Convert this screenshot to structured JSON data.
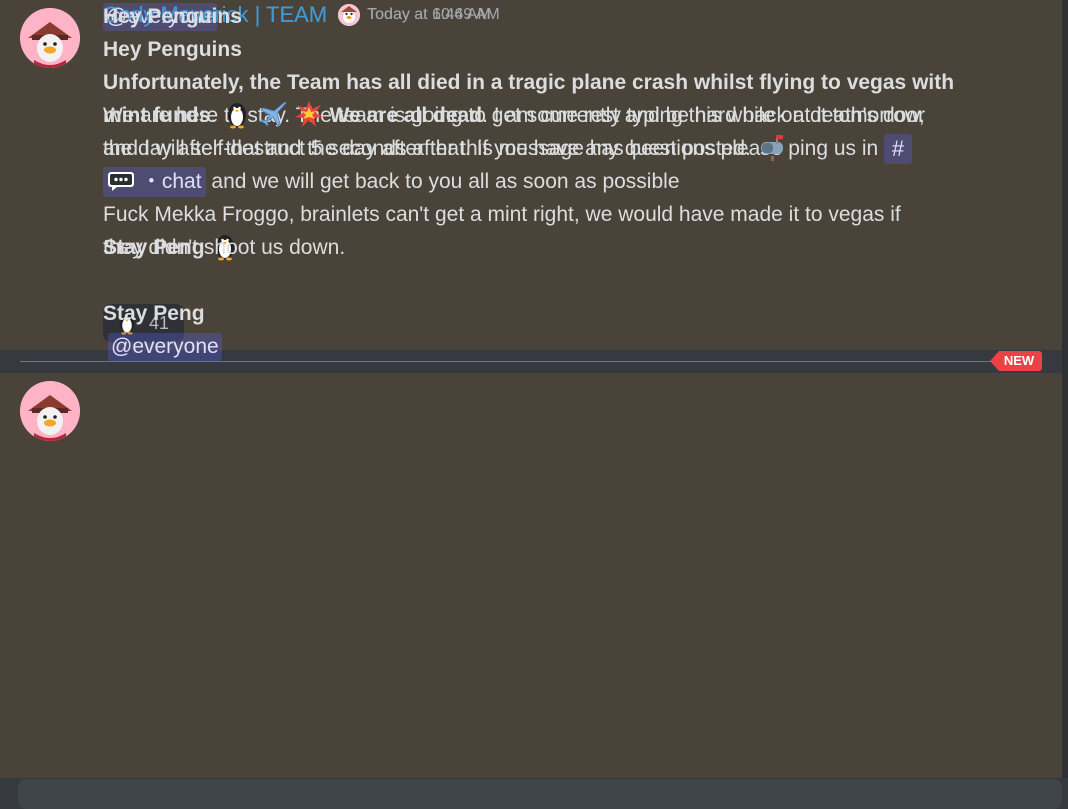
{
  "messages": [
    {
      "username": "Cody Maverick | TEAM",
      "timestamp": "Today at 6:46 AM",
      "mention": "@everyone",
      "greeting": "Hey Penguins",
      "body_line1": "We are here to stay. The team is going to get some rest and be hard back at it tomorrow,",
      "body_line2": "the day after that and the day after that. If you have any questions please ping us in",
      "channel_hash": "#",
      "channel_name": "・chat",
      "body_line3_rest": "and we will get back to you all as soon as possible",
      "signoff": "Stay Peng",
      "reaction": {
        "emoji": "penguin",
        "count": "41"
      }
    },
    {
      "username": "Cody Maverick | TEAM",
      "timestamp": "Today at 10:49 AM",
      "greeting": "Hey Penguins",
      "bold_line1": "Unfortunately, the Team has all died in a tragic plane crash whilst flying to vegas with",
      "bold_line2_start": "mint funds",
      "punct_period": ".",
      "bold_we_are_dead": "We are all dead",
      "line2_rest": ". I am currently typing this while on death's door",
      "line3": "and I will self-destruct 5 seconds after this message has been posted.",
      "para2_line1": "Fuck Mekka Froggo, brainlets can't get a mint right, we would have made it to vegas if",
      "para2_line2": "they didn't shoot us down.",
      "signoff": "Stay Peng",
      "mention": "@everyone"
    }
  ],
  "divider": {
    "label": "NEW"
  },
  "colors": {
    "background": "#36393f",
    "message_highlight": "#49433a",
    "username": "#3d9ad6",
    "new_divider": "#ed4245",
    "mention_bg": "#5865f24d"
  }
}
